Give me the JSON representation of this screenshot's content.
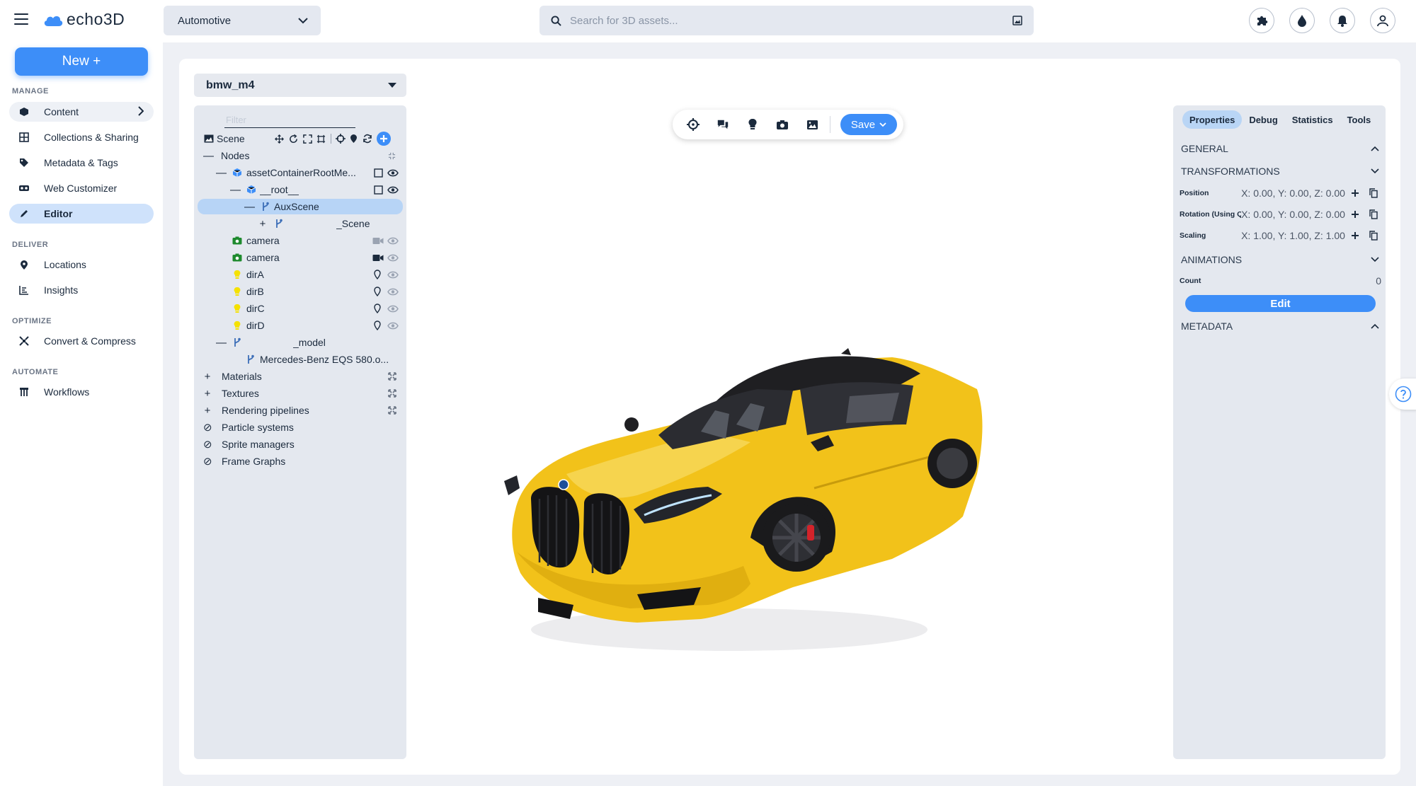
{
  "app": {
    "logo_text": "echo3D"
  },
  "header": {
    "project_select": "Automotive",
    "search_placeholder": "Search for 3D assets...",
    "icons": [
      "puzzle-icon",
      "drop-icon",
      "bell-icon",
      "user-icon"
    ]
  },
  "sidebar": {
    "new_button": "New +",
    "sections": [
      {
        "label": "MANAGE",
        "items": [
          "Content",
          "Collections & Sharing",
          "Metadata & Tags",
          "Web Customizer",
          "Editor"
        ]
      },
      {
        "label": "DELIVER",
        "items": [
          "Locations",
          "Insights"
        ]
      },
      {
        "label": "OPTIMIZE",
        "items": [
          "Convert & Compress"
        ]
      },
      {
        "label": "AUTOMATE",
        "items": [
          "Workflows"
        ]
      }
    ],
    "active_item": "Editor"
  },
  "editor": {
    "model_select": "bmw_m4",
    "filter_placeholder": "Filter",
    "tree": [
      {
        "label": "Scene",
        "sign": "",
        "icon": "image-icon"
      },
      {
        "label": "Nodes",
        "sign": "—",
        "icon": ""
      },
      {
        "label": "assetContainerRootMe...",
        "sign": "—",
        "icon": "cube-icon"
      },
      {
        "label": "__root__",
        "sign": "—",
        "icon": "cube-icon"
      },
      {
        "label": "AuxScene",
        "sign": "—",
        "icon": "branch-icon"
      },
      {
        "label": "_Scene",
        "sign": "+",
        "icon": "branch-icon"
      },
      {
        "label": "camera",
        "sign": "",
        "icon": "camera-icon"
      },
      {
        "label": "camera",
        "sign": "",
        "icon": "camera-icon"
      },
      {
        "label": "dirA",
        "sign": "",
        "icon": "light-icon"
      },
      {
        "label": "dirB",
        "sign": "",
        "icon": "light-icon"
      },
      {
        "label": "dirC",
        "sign": "",
        "icon": "light-icon"
      },
      {
        "label": "dirD",
        "sign": "",
        "icon": "light-icon"
      },
      {
        "label": "_model",
        "sign": "—",
        "icon": "branch-icon"
      },
      {
        "label": "Mercedes-Benz EQS 580.o...",
        "sign": "",
        "icon": "branch-icon"
      },
      {
        "label": "Materials",
        "sign": "+",
        "icon": ""
      },
      {
        "label": "Textures",
        "sign": "+",
        "icon": ""
      },
      {
        "label": "Rendering pipelines",
        "sign": "+",
        "icon": ""
      },
      {
        "label": "Particle systems",
        "sign": "⊘",
        "icon": ""
      },
      {
        "label": "Sprite managers",
        "sign": "⊘",
        "icon": ""
      },
      {
        "label": "Frame Graphs",
        "sign": "⊘",
        "icon": ""
      }
    ],
    "toolbar": {
      "save_label": "Save"
    }
  },
  "properties": {
    "tabs": [
      "Properties",
      "Debug",
      "Statistics",
      "Tools"
    ],
    "active_tab": "Properties",
    "sections": {
      "general": "GENERAL",
      "transformations": "TRANSFORMATIONS",
      "animations": "ANIMATIONS",
      "metadata": "METADATA"
    },
    "position_label": "Position",
    "position_value": "X: 0.00, Y: 0.00, Z: 0.00",
    "rotation_label": "Rotation (Using Q",
    "rotation_value": "X: 0.00, Y: 0.00, Z: 0.00",
    "scaling_label": "Scaling",
    "scaling_value": "X: 1.00, Y: 1.00, Z: 1.00",
    "count_label": "Count",
    "count_value": "0",
    "edit_button": "Edit"
  },
  "colors": {
    "accent": "#3d8ef8",
    "car_body": "#f2c21a",
    "light_icon": "#f5e100",
    "camera_icon": "#1e8a2e",
    "cube_icon": "#3d8ef8"
  }
}
